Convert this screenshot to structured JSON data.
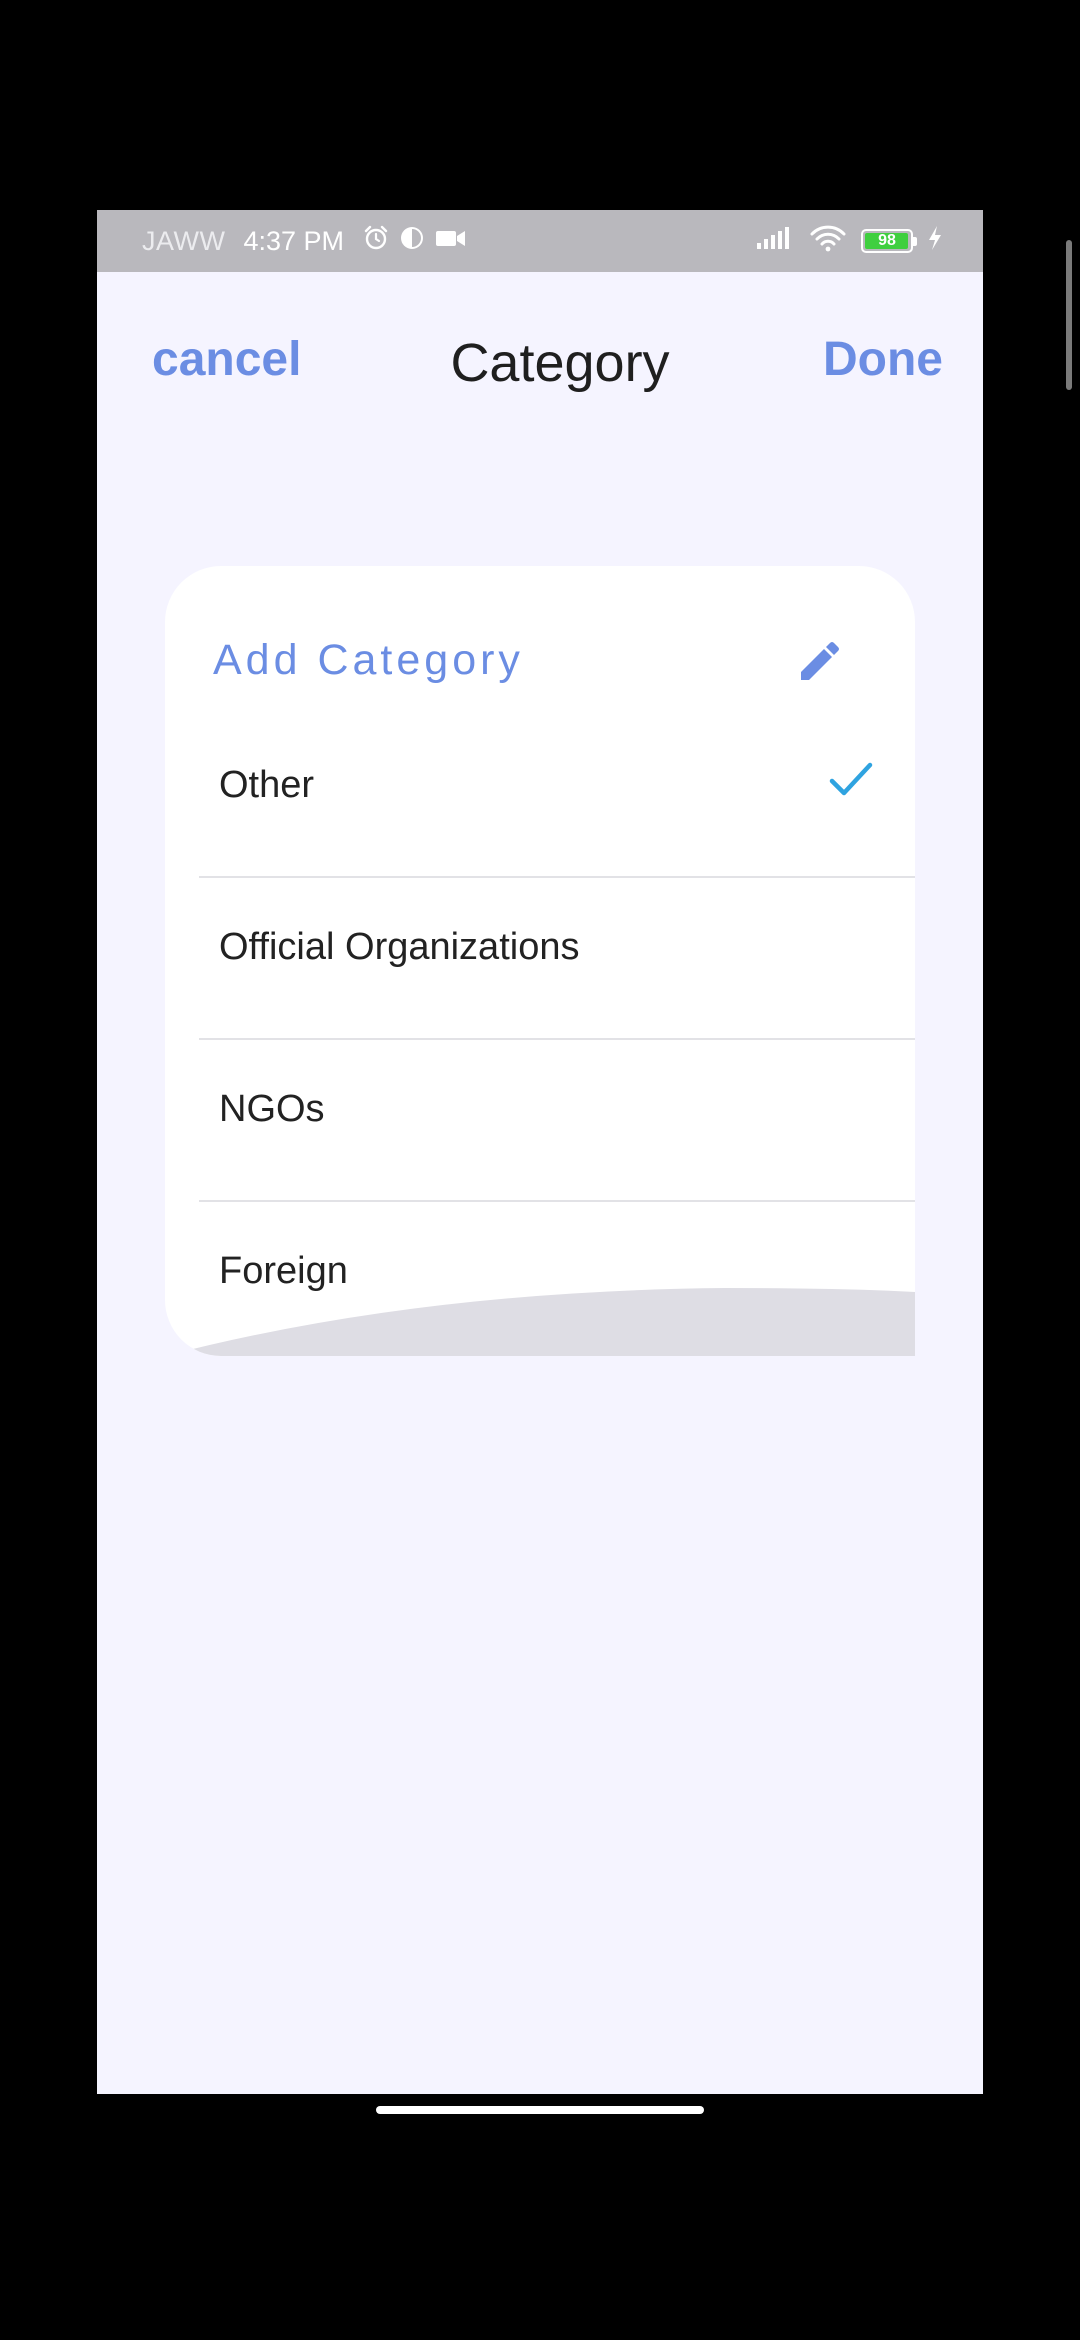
{
  "status_bar": {
    "carrier": "JAWW",
    "time": "4:37 PM",
    "battery_level": "98",
    "battery_fraction": 0.98,
    "colors": {
      "background": "#b9b8bd",
      "battery": "#3fcf3f"
    }
  },
  "nav": {
    "cancel_label": "cancel",
    "title": "Category",
    "done_label": "Done"
  },
  "card": {
    "add_label": "Add Category",
    "items": [
      {
        "label": "Other",
        "selected": true
      },
      {
        "label": "Official Organizations",
        "selected": false
      },
      {
        "label": "NGOs",
        "selected": false
      },
      {
        "label": "Foreign",
        "selected": false
      }
    ]
  },
  "colors": {
    "accent": "#6b8de3",
    "check": "#2fa3e0",
    "screen_background": "#f5f4ff"
  },
  "icons": {
    "edit": "pencil-icon",
    "check": "check-icon",
    "alarm": "alarm-icon",
    "video": "video-icon",
    "signal": "signal-icon",
    "wifi": "wifi-icon",
    "charging": "charging-icon"
  }
}
